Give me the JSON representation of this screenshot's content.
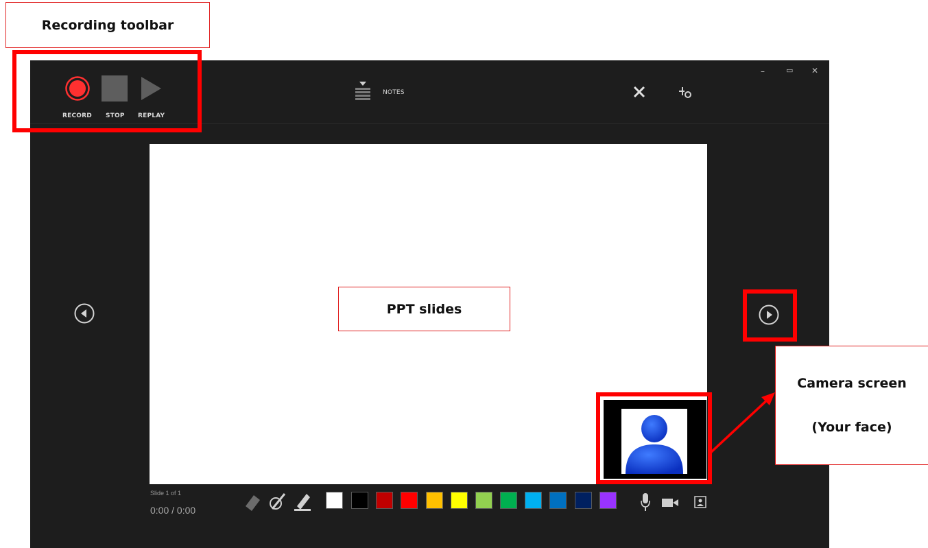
{
  "callouts": {
    "recording_toolbar": "Recording toolbar",
    "ppt_slides": "PPT slides",
    "camera_line1": "Camera screen",
    "camera_line2": "(Your face)"
  },
  "toolbar": {
    "record_label": "RECORD",
    "stop_label": "STOP",
    "replay_label": "REPLAY",
    "notes_label": "NOTES"
  },
  "window_controls": {
    "minimize": "–",
    "restore": "▭",
    "close": "✕"
  },
  "footer": {
    "slide_counter": "Slide 1 of 1",
    "timer": "0:00 / 0:00"
  },
  "colors": {
    "accent_red": "#ff0000",
    "record_red": "#ff3030",
    "palette": [
      "#ffffff",
      "#000000",
      "#c00000",
      "#ff0000",
      "#ffc000",
      "#ffff00",
      "#92d050",
      "#00b050",
      "#00b0f0",
      "#0070c0",
      "#002060",
      "#9933ff"
    ]
  },
  "icons": [
    "record-icon",
    "stop-icon",
    "replay-icon",
    "notes-icon",
    "close-icon",
    "settings-icon",
    "previous-slide-icon",
    "next-slide-icon",
    "eraser-icon",
    "pen-icon",
    "highlighter-icon",
    "microphone-icon",
    "camera-icon",
    "camera-preview-icon",
    "person-icon"
  ]
}
